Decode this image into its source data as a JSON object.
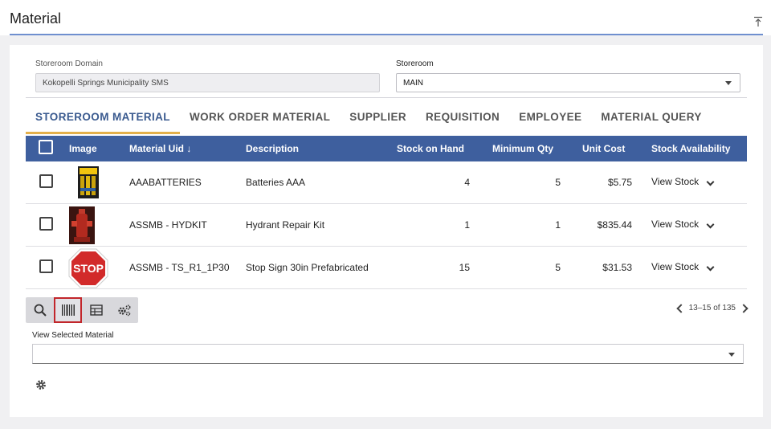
{
  "header": {
    "title": "Material",
    "collapse_icon": "collapse-up-icon"
  },
  "filters": {
    "domain_label": "Storeroom Domain",
    "domain_value": "Kokopelli Springs Municipality SMS",
    "storeroom_label": "Storeroom",
    "storeroom_value": "MAIN"
  },
  "tabs": [
    {
      "label": "STOREROOM MATERIAL",
      "active": true
    },
    {
      "label": "WORK ORDER MATERIAL",
      "active": false
    },
    {
      "label": "SUPPLIER",
      "active": false
    },
    {
      "label": "REQUISITION",
      "active": false
    },
    {
      "label": "EMPLOYEE",
      "active": false
    },
    {
      "label": "MATERIAL QUERY",
      "active": false
    }
  ],
  "table": {
    "columns": [
      "Image",
      "Material Uid ↓",
      "Description",
      "Stock on Hand",
      "Minimum Qty",
      "Unit Cost",
      "Stock Availability"
    ],
    "rows": [
      {
        "image": "batteries-thumbnail",
        "uid": "AAABATTERIES",
        "description": "Batteries AAA",
        "stock": "4",
        "min_qty": "5",
        "cost": "$5.75",
        "availability": "View Stock"
      },
      {
        "image": "hydrant-thumbnail",
        "uid": "ASSMB - HYDKIT",
        "description": "Hydrant Repair Kit",
        "stock": "1",
        "min_qty": "1",
        "cost": "$835.44",
        "availability": "View Stock"
      },
      {
        "image": "stop-sign-thumbnail",
        "stop_text": "STOP",
        "uid": "ASSMB - TS_R1_1P30",
        "description": "Stop Sign 30in Prefabricated",
        "stock": "15",
        "min_qty": "5",
        "cost": "$31.53",
        "availability": "View Stock"
      }
    ]
  },
  "toolbar": {
    "icons": [
      "search-icon",
      "barcode-icon",
      "table-icon",
      "settings-cog-icon"
    ]
  },
  "pager": {
    "text": "13–15 of 135"
  },
  "view_selected": {
    "label": "View Selected Material",
    "value": ""
  },
  "colors": {
    "header_blue": "#3e5f9e",
    "tab_active": "#3a5a8f",
    "tab_underline": "#e3b04b",
    "selected_outline": "#c2262b"
  }
}
